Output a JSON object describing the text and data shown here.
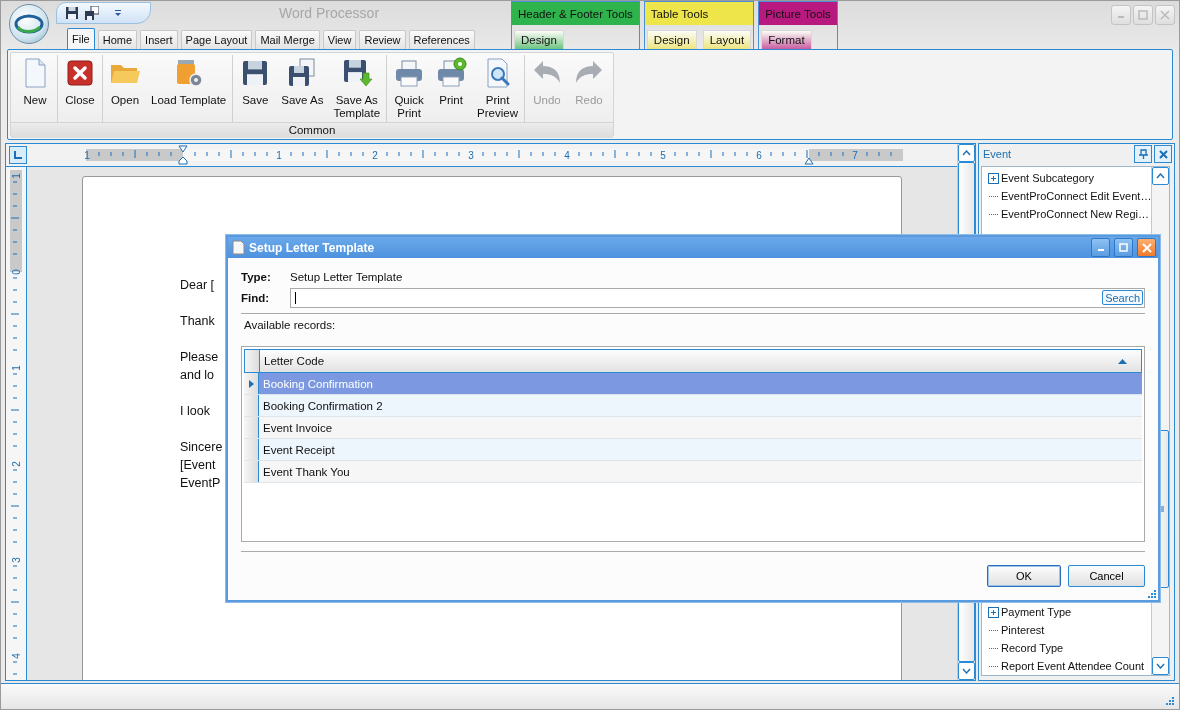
{
  "window": {
    "title": "Word Processor"
  },
  "tabs": [
    {
      "label": "File",
      "selected": true
    },
    {
      "label": "Home",
      "selected": false
    },
    {
      "label": "Insert",
      "selected": false
    },
    {
      "label": "Page Layout",
      "selected": false
    },
    {
      "label": "Mail Merge",
      "selected": false
    },
    {
      "label": "View",
      "selected": false
    },
    {
      "label": "Review",
      "selected": false
    },
    {
      "label": "References",
      "selected": false
    }
  ],
  "contextual_groups": [
    {
      "title": "Header & Footer Tools",
      "color": "#2fb34c",
      "tabs": [
        {
          "label": "Design",
          "selected": false
        }
      ]
    },
    {
      "title": "Table Tools",
      "color": "#eee54a",
      "tabs": [
        {
          "label": "Design",
          "selected": false
        },
        {
          "label": "Layout",
          "selected": false
        }
      ]
    },
    {
      "title": "Picture Tools",
      "color": "#b8197e",
      "tabs": [
        {
          "label": "Format",
          "selected": false
        }
      ]
    }
  ],
  "ribbon": {
    "groups": [
      {
        "label": "Common",
        "sections": [
          [
            {
              "label": "New",
              "kind": "new",
              "disabled": false
            }
          ],
          [
            {
              "label": "Close",
              "kind": "close",
              "disabled": false
            }
          ],
          [
            {
              "label": "Open",
              "kind": "open",
              "disabled": false
            },
            {
              "label": "Load Template",
              "kind": "template",
              "disabled": false
            }
          ],
          [
            {
              "label": "Save",
              "kind": "save",
              "disabled": false
            },
            {
              "label": "Save As",
              "kind": "save-as",
              "disabled": false
            },
            {
              "label": "Save As\nTemplate",
              "kind": "save-template",
              "disabled": false
            }
          ],
          [
            {
              "label": "Quick\nPrint",
              "kind": "quick-print",
              "disabled": false
            },
            {
              "label": "Print",
              "kind": "print",
              "disabled": false
            },
            {
              "label": "Print\nPreview",
              "kind": "preview",
              "disabled": false
            }
          ],
          [
            {
              "label": "Undo",
              "kind": "undo",
              "disabled": true
            },
            {
              "label": "Redo",
              "kind": "redo",
              "disabled": true
            }
          ]
        ]
      }
    ]
  },
  "ruler": {
    "horizontal": [
      "1",
      "1",
      "2",
      "3",
      "4",
      "5",
      "6",
      "7"
    ],
    "vertical": [
      "1",
      "0",
      "1",
      "2",
      "3",
      "4"
    ]
  },
  "document": {
    "paragraphs": [
      [
        "Dear ["
      ],
      [
        "Thank"
      ],
      [
        "Please",
        "and lo"
      ],
      [
        "I look"
      ],
      [
        "Sincere",
        "[Event",
        "EventP"
      ]
    ]
  },
  "event_panel": {
    "title": "Event",
    "items_top": [
      {
        "label": "Event Subcategory",
        "expandable": true
      },
      {
        "label": "EventProConnect Edit Event…",
        "expandable": false
      },
      {
        "label": "EventProConnect New Regi…",
        "expandable": false
      }
    ],
    "items_bottom": [
      {
        "label": "Payment Type",
        "expandable": true
      },
      {
        "label": "Pinterest",
        "expandable": false
      },
      {
        "label": "Record Type",
        "expandable": false
      },
      {
        "label": "Report Event Attendee Count",
        "expandable": false
      }
    ]
  },
  "dialog": {
    "title": "Setup Letter Template",
    "type_label": "Type:",
    "type_value": "Setup Letter Template",
    "find_label": "Find:",
    "search_button": "Search",
    "records_label": "Available records:",
    "grid": {
      "columns": [
        {
          "label": "Letter Code",
          "sort_ascending": true
        }
      ],
      "rows": [
        {
          "cells": [
            "Booking Confirmation"
          ],
          "selected": true
        },
        {
          "cells": [
            "Booking Confirmation 2"
          ],
          "selected": false
        },
        {
          "cells": [
            "Event Invoice"
          ],
          "selected": false
        },
        {
          "cells": [
            "Event Receipt"
          ],
          "selected": false
        },
        {
          "cells": [
            "Event Thank You"
          ],
          "selected": false
        }
      ]
    },
    "buttons": [
      {
        "label": "OK",
        "default": true
      },
      {
        "label": "Cancel",
        "default": false
      }
    ]
  }
}
